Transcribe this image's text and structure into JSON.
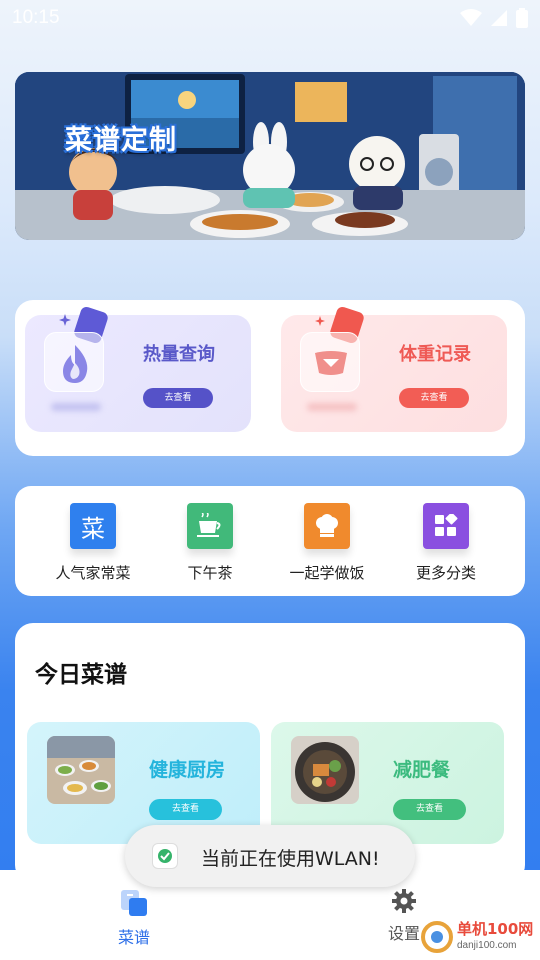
{
  "status_bar": {
    "time": "10:15"
  },
  "banner": {
    "title": "菜谱定制"
  },
  "features": [
    {
      "title": "热量查询",
      "button": "去查看",
      "icon": "fire-icon"
    },
    {
      "title": "体重记录",
      "button": "去查看",
      "icon": "scale-icon"
    }
  ],
  "categories": [
    {
      "label": "人气家常菜",
      "icon_text": "菜",
      "color": "#2f80ee"
    },
    {
      "label": "下午茶",
      "icon_text": "☕",
      "color": "#41b97a"
    },
    {
      "label": "一起学做饭",
      "icon_text": "chef-hat",
      "color": "#f08a2d"
    },
    {
      "label": "更多分类",
      "icon_text": "grid",
      "color": "#8a4fe0"
    }
  ],
  "today": {
    "title": "今日菜谱",
    "cards": [
      {
        "title": "健康厨房",
        "button": "去查看"
      },
      {
        "title": "减肥餐",
        "button": "去查看"
      }
    ]
  },
  "toast": {
    "text": "当前正在使用WLAN!"
  },
  "nav": [
    {
      "label": "菜谱",
      "icon": "recipe-icon",
      "active": true
    },
    {
      "label": "设置",
      "icon": "gear-icon",
      "active": false
    }
  ],
  "watermark": {
    "title": "单机100网",
    "sub": "danji100.com"
  }
}
